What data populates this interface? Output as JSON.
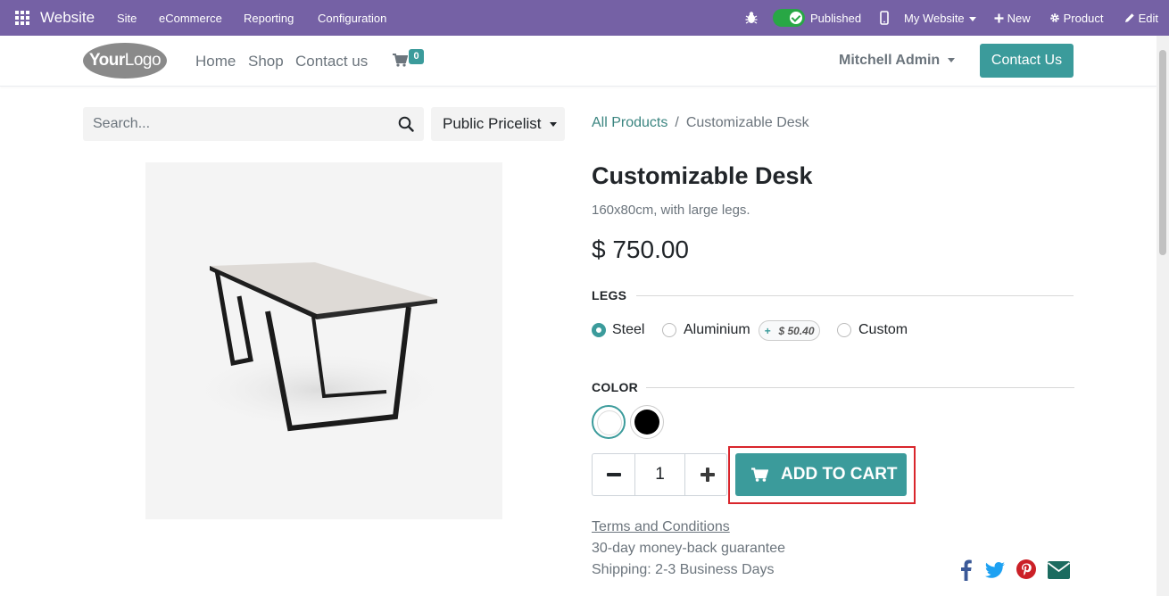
{
  "adminbar": {
    "app_title": "Website",
    "menu": [
      "Site",
      "eCommerce",
      "Reporting",
      "Configuration"
    ],
    "published_label": "Published",
    "website_label": "My Website",
    "new_label": "New",
    "product_label": "Product",
    "edit_label": "Edit"
  },
  "header": {
    "logo_text_bold": "Your",
    "logo_text": "Logo",
    "nav": [
      "Home",
      "Shop",
      "Contact us"
    ],
    "cart_count": "0",
    "user": "Mitchell Admin",
    "contact_button": "Contact Us"
  },
  "search": {
    "placeholder": "Search...",
    "pricelist": "Public Pricelist"
  },
  "breadcrumb": {
    "parent": "All Products",
    "separator": "/",
    "current": "Customizable Desk"
  },
  "product": {
    "name": "Customizable Desk",
    "description": "160x80cm, with large legs.",
    "price": "$ 750.00",
    "legs_label": "LEGS",
    "legs_options": [
      {
        "label": "Steel",
        "selected": true
      },
      {
        "label": "Aluminium",
        "selected": false,
        "extra_plus": "+",
        "extra_price": "$ 50.40"
      },
      {
        "label": "Custom",
        "selected": false
      }
    ],
    "color_label": "COLOR",
    "colors": [
      {
        "name": "white",
        "hex": "#ffffff",
        "selected": true
      },
      {
        "name": "black",
        "hex": "#000000",
        "selected": false
      }
    ],
    "quantity": "1",
    "add_to_cart": "ADD TO CART",
    "terms": "Terms and Conditions",
    "guarantee": "30-day money-back guarantee",
    "shipping": "Shipping: 2-3 Business Days"
  },
  "colors": {
    "admin_bar": "#7561a5",
    "primary": "#3b9b9b",
    "link": "#3b8580",
    "highlight_border": "#d9262c"
  },
  "share_icons": [
    "facebook-icon",
    "twitter-icon",
    "pinterest-icon",
    "envelope-icon"
  ]
}
